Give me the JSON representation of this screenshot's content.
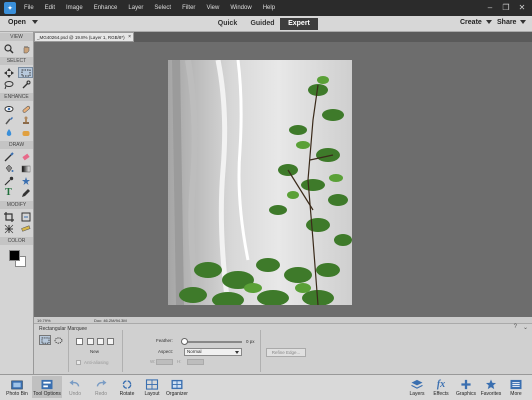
{
  "menubar": {
    "items": [
      "File",
      "Edit",
      "Image",
      "Enhance",
      "Layer",
      "Select",
      "Filter",
      "View",
      "Window",
      "Help"
    ]
  },
  "modebar": {
    "open_label": "Open",
    "tabs": [
      {
        "label": "Quick",
        "active": false
      },
      {
        "label": "Guided",
        "active": false
      },
      {
        "label": "Expert",
        "active": true
      }
    ],
    "create_label": "Create",
    "share_label": "Share"
  },
  "toolbox": {
    "sections": [
      "VIEW",
      "SELECT",
      "ENHANCE",
      "DRAW",
      "MODIFY",
      "COLOR"
    ]
  },
  "document": {
    "tab_label": "_MG40264.psd @ 19.8% (Layer 1, RGB/8*)",
    "zoom": "19.79%",
    "doc_info": "Doc: 46.2M/94.3M"
  },
  "tool_options": {
    "tool_name": "Rectangular Marquee",
    "new_label": "New",
    "anti_alias_label": "Anti-aliasing",
    "feather_label": "Feather:",
    "feather_value": "0 px",
    "feather_level": 0,
    "aspect_label": "Aspect:",
    "aspect_value": "Normal",
    "w_label": "W:",
    "h_label": "H:",
    "refine_label": "Refine Edge..."
  },
  "taskbar": {
    "left": [
      {
        "label": "Photo Bin",
        "icon": "photo-bin-icon"
      },
      {
        "label": "Tool Options",
        "icon": "tool-options-icon"
      },
      {
        "label": "Undo",
        "icon": "undo-icon"
      },
      {
        "label": "Redo",
        "icon": "redo-icon"
      },
      {
        "label": "Rotate",
        "icon": "rotate-icon"
      },
      {
        "label": "Layout",
        "icon": "layout-icon"
      },
      {
        "label": "Organizer",
        "icon": "organizer-icon"
      }
    ],
    "right": [
      {
        "label": "Layers",
        "icon": "layers-icon"
      },
      {
        "label": "Effects",
        "icon": "effects-icon"
      },
      {
        "label": "Graphics",
        "icon": "graphics-icon"
      },
      {
        "label": "Favorites",
        "icon": "favorites-icon"
      },
      {
        "label": "More",
        "icon": "more-icon"
      }
    ]
  },
  "colors": {
    "foreground": "#000000",
    "background": "#ffffff",
    "accent": "#3a8fd9"
  }
}
